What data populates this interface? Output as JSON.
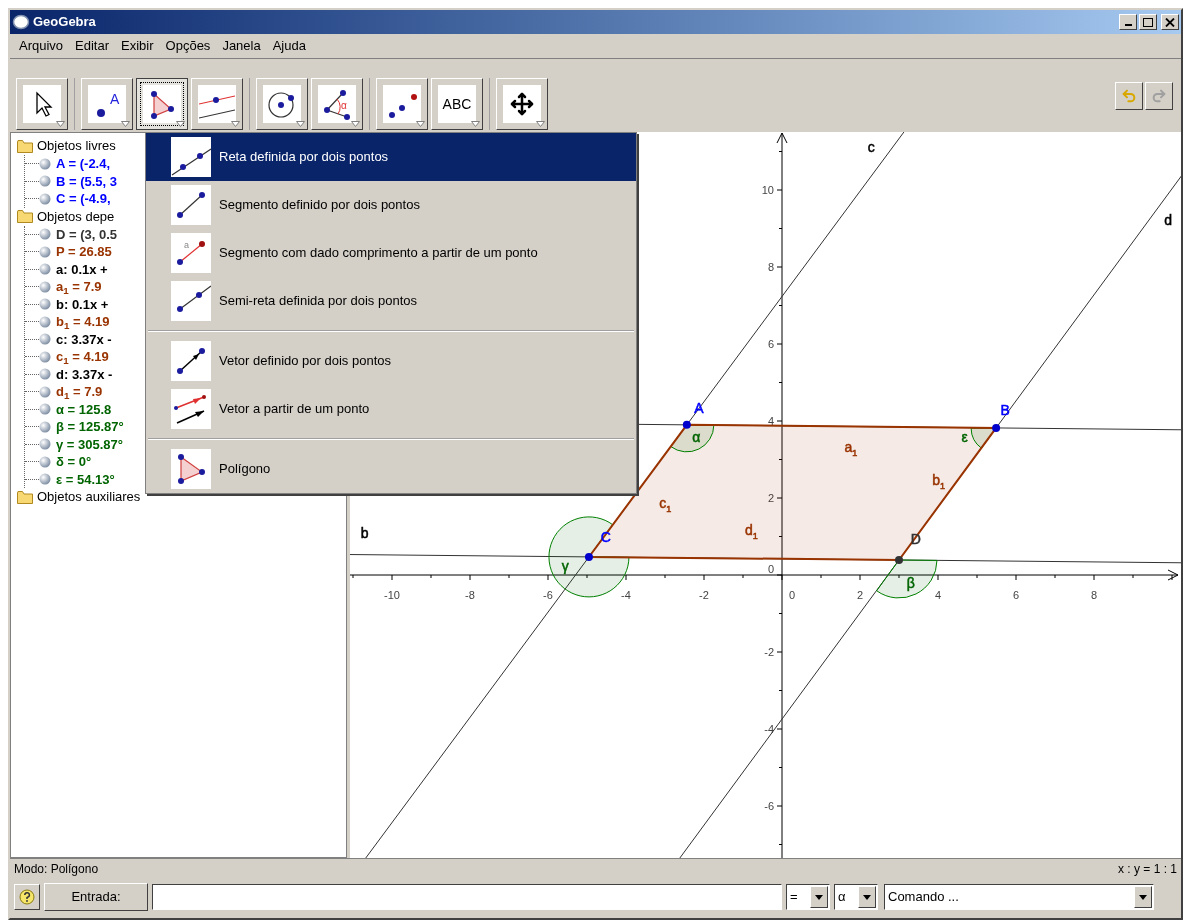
{
  "window": {
    "title": "GeoGebra"
  },
  "menu_bar": [
    "Arquivo",
    "Editar",
    "Exibir",
    "Opções",
    "Janela",
    "Ajuda"
  ],
  "toolbar": {
    "tool_groups": [
      [
        {
          "kind": "pointer",
          "selected": false
        }
      ],
      [
        {
          "kind": "point",
          "icon_label": "A",
          "selected": false
        },
        {
          "kind": "polygon",
          "selected": true
        },
        {
          "kind": "parallel",
          "selected": false
        }
      ],
      [
        {
          "kind": "circle",
          "selected": false
        },
        {
          "kind": "angle",
          "icon_label": "α",
          "selected": false
        }
      ],
      [
        {
          "kind": "reflect",
          "selected": false
        },
        {
          "kind": "text",
          "label": "ABC",
          "selected": false
        }
      ],
      [
        {
          "kind": "move",
          "selected": false
        }
      ]
    ],
    "undo": {
      "disabled": false
    },
    "redo": {
      "disabled": true
    }
  },
  "algebra_view": {
    "folders": [
      {
        "label": "Objetos livres",
        "children": [
          {
            "text": "A = (-2.4,",
            "color": "#0000ff"
          },
          {
            "text": "B = (5.5, 3",
            "color": "#0000ff"
          },
          {
            "text": "C = (-4.9,",
            "color": "#0000ff"
          }
        ]
      },
      {
        "label": "Objetos depe",
        "children": [
          {
            "text": "D = (3, 0.5",
            "color": "#333333"
          },
          {
            "text": "P = 26.85",
            "color": "#993300"
          },
          {
            "text": "a: 0.1x +",
            "color": "#000000"
          },
          {
            "text": "a$_{1}$ = 7.9",
            "color": "#993300"
          },
          {
            "text": "b: 0.1x +",
            "color": "#000000"
          },
          {
            "text": "b$_{1}$ = 4.19",
            "color": "#993300"
          },
          {
            "text": "c: 3.37x -",
            "color": "#000000"
          },
          {
            "text": "c$_{1}$ = 4.19",
            "color": "#993300"
          },
          {
            "text": "d: 3.37x -",
            "color": "#000000"
          },
          {
            "text": "d$_{1}$ = 7.9",
            "color": "#993300"
          },
          {
            "text": "α = 125.8",
            "color": "#006400"
          },
          {
            "text": "β = 125.87°",
            "color": "#006400"
          },
          {
            "text": "γ = 305.87°",
            "color": "#006400"
          },
          {
            "text": "δ = 0°",
            "color": "#006400"
          },
          {
            "text": "ε = 54.13°",
            "color": "#006400"
          }
        ]
      },
      {
        "label": "Objetos auxiliares"
      }
    ]
  },
  "tool_menu": {
    "sections": [
      [
        {
          "kind": "line",
          "label": "Reta definida por dois pontos",
          "selected": true
        },
        {
          "kind": "segment",
          "label": "Segmento definido por dois pontos",
          "selected": false
        },
        {
          "kind": "segment_length",
          "icon_label": "a",
          "label": "Segmento com dado comprimento a partir de um ponto",
          "selected": false
        },
        {
          "kind": "ray",
          "label": "Semi-reta definida por dois pontos",
          "selected": false
        }
      ],
      [
        {
          "kind": "vector",
          "label": "Vetor definido por dois pontos",
          "selected": false
        },
        {
          "kind": "vector_from_point",
          "label": "Vetor a partir de um ponto",
          "selected": false
        }
      ],
      [
        {
          "kind": "polygon",
          "label": "Polígono",
          "selected": false
        }
      ]
    ]
  },
  "graphics_view": {
    "x_ticks": [
      "-10",
      "-8",
      "-6",
      "-4",
      "-2",
      "0",
      "2",
      "4",
      "6",
      "8"
    ],
    "y_ticks": [
      "10",
      "8",
      "6",
      "4",
      "2",
      "0",
      "-2",
      "-4",
      "-6"
    ],
    "labels": [
      {
        "text": "c",
        "color": "#000000"
      },
      {
        "text": "d",
        "color": "#000000"
      },
      {
        "text": "b",
        "color": "#000000"
      },
      {
        "text": "A",
        "color": "#0000ff"
      },
      {
        "text": "B",
        "color": "#0000ff"
      },
      {
        "text": "C",
        "color": "#0000ff"
      },
      {
        "text": "D",
        "color": "#333333"
      },
      {
        "text": "a",
        "sub": "1",
        "color": "#993300"
      },
      {
        "text": "b",
        "sub": "1",
        "color": "#993300"
      },
      {
        "text": "c",
        "sub": "1",
        "color": "#993300"
      },
      {
        "text": "d",
        "sub": "1",
        "color": "#993300"
      },
      {
        "text": "α",
        "color": "#006400"
      },
      {
        "text": "β",
        "color": "#006400"
      },
      {
        "text": "γ",
        "color": "#006400"
      },
      {
        "text": "ε",
        "color": "#006400"
      }
    ]
  },
  "status_bar": {
    "mode": "Modo: Polígono",
    "scale": "x : y = 1 : 1"
  },
  "input_bar": {
    "button": "Entrada:",
    "dropdowns": [
      "=",
      "α",
      "Comando ..."
    ]
  }
}
